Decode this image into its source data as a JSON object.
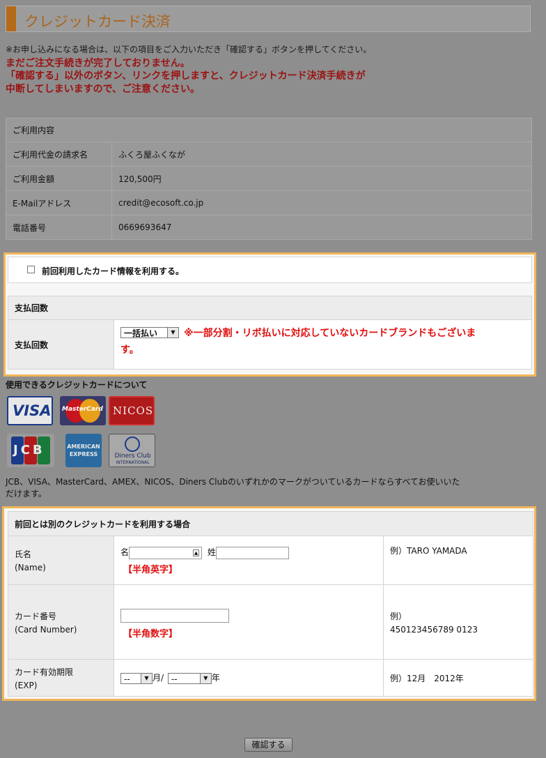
{
  "header": {
    "title": "クレジットカード決済"
  },
  "notice": "※お申し込みになる場合は、以下の項目をご入力いただき「確認する」ボタンを押してください。",
  "warning": {
    "line1": "まだご注文手続きが完了しておりません。",
    "line2": "「確認する」以外のボタン、リンクを押しますと、クレジットカード決済手続きが",
    "line3": "中断してしまいますので、ご注意ください。"
  },
  "usage": {
    "heading": "ご利用内容",
    "rows": [
      {
        "label": "ご利用代金の請求名",
        "value": "ふくろ屋ふくなが"
      },
      {
        "label": "ご利用金額",
        "value": "120,500円"
      },
      {
        "label": "E-Mailアドレス",
        "value": "credit@ecosoft.co.jp"
      },
      {
        "label": "電話番号",
        "value": "0669693647"
      }
    ]
  },
  "previous_card": {
    "label": "前回利用したカード情報を利用する。"
  },
  "payment": {
    "heading": "支払回数",
    "label": "支払回数",
    "selected": "一括払い",
    "note_line1": "※一部分割・リボ払いに対応していないカードブランドもございま",
    "note_line2": "す。"
  },
  "cards": {
    "heading": "使用できるクレジットカードについて",
    "logos": [
      "VISA",
      "MasterCard",
      "NICOS",
      "JCB",
      "AMERICAN EXPRESS",
      "Diners Club"
    ],
    "diners_sub": "INTERNATIONAL",
    "description_line1": "JCB、VISA、MasterCard、AMEX、NICOS、Diners Clubのいずれかのマークがついているカードならすべてお使いいた",
    "description_line2": "だけます。"
  },
  "new_card": {
    "heading": "前回とは別のクレジットカードを利用する場合",
    "name": {
      "label1": "氏名",
      "label2": "(Name)",
      "first": "名",
      "last": "姓",
      "hint": "【半角英字】",
      "example": "例）TARO YAMADA"
    },
    "number": {
      "label1": "カード番号",
      "label2": "(Card Number)",
      "hint": "【半角数字】",
      "example1": "例）",
      "example2": "450123456789 0123"
    },
    "exp": {
      "label1": "カード有効期限",
      "label2": "(EXP)",
      "month_selected": "--",
      "month_unit": "月/",
      "year_selected": "--",
      "year_unit": "年",
      "example": "例）12月　2012年"
    }
  },
  "confirm_button": "確認する",
  "colors": {
    "accent": "#f0b65a",
    "warning": "#e01010",
    "title": "#a9661f"
  }
}
